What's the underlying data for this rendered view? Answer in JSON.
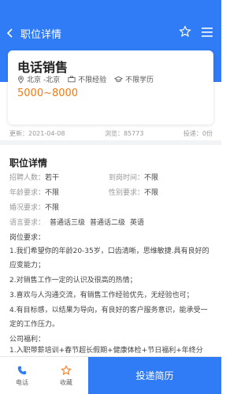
{
  "header": {
    "title": "职位详情"
  },
  "card": {
    "job_title": "电话销售",
    "location": "北京 -北京",
    "experience": "不限经验",
    "education": "不限学历",
    "salary": "5000~8000"
  },
  "meta": {
    "updated": "更新：2021-04-08",
    "views": "浏览：85773",
    "applied": "投递：0份"
  },
  "details": {
    "section_title": "职位详情",
    "left": [
      {
        "label": "招聘人数：",
        "value": "若干"
      },
      {
        "label": "年龄要求：",
        "value": "不限"
      },
      {
        "label": "婚况要求：",
        "value": "不限"
      }
    ],
    "right": [
      {
        "label": "到岗时间：",
        "value": "不限"
      },
      {
        "label": "性别要求：",
        "value": "不限"
      }
    ],
    "language_label": "语言要求：",
    "languages": [
      "普通话三级",
      "普通话二级",
      "英语"
    ],
    "requirements_title": "岗位要求：",
    "requirements": [
      "1.我们希望你的年龄20-35岁，口齿清晰，思维敏捷.具有良好的应变能力；",
      "2.对销售工作一定的认识及很高的热情；",
      "3.喜欢与人沟通交流，有销售工作经验优先，无经验也可；",
      "4.有目标感，以结果为导向，有良好的客户服务意识，能承受一定的工作压力。"
    ],
    "welfare_title": "公司福利：",
    "welfare": [
      "1.入职带薪培训+春节超长假期+健康体检+节日福利+年终分"
    ]
  },
  "bottom": {
    "call_label": "电话",
    "favorite_label": "收藏",
    "apply_label": "投递简历"
  },
  "colors": {
    "primary": "#2f7cf6",
    "salary": "#f07a18"
  }
}
